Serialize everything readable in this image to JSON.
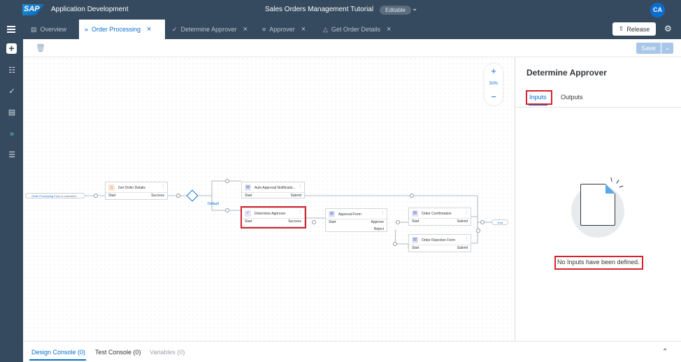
{
  "shell": {
    "logo_text": "SAP",
    "app_title": "Application Development",
    "project_title": "Sales Orders Management Tutorial",
    "status_badge": "Editable",
    "avatar_initials": "CA"
  },
  "tabs": [
    {
      "label": "Overview",
      "icon": "document-icon",
      "closable": false
    },
    {
      "label": "Order Processing",
      "icon": "process-icon",
      "closable": true,
      "active": true
    },
    {
      "label": "Determine Approver",
      "icon": "decision-icon",
      "closable": true
    },
    {
      "label": "Approver",
      "icon": "code-icon",
      "closable": true
    },
    {
      "label": "Get Order Details",
      "icon": "action-icon",
      "closable": true
    }
  ],
  "toolbar": {
    "release_label": "Release",
    "save_label": "Save"
  },
  "zoom": {
    "in": "+",
    "level": "50%",
    "out": "−"
  },
  "flow": {
    "trigger_label": "Order Processing Form",
    "trigger_suffix": "is submitted",
    "end_label": "End",
    "default_label": "Default",
    "nodes": {
      "get_order_details": {
        "title": "Get Order Details",
        "in": "Start",
        "out": "Success"
      },
      "auto_approval": {
        "title": "Auto Approval Notificatio...",
        "in": "Start",
        "out": "Submit"
      },
      "determine_approver": {
        "title": "Determine Approver",
        "in": "Start",
        "out": "Success"
      },
      "approval_form": {
        "title": "Approval Form",
        "in": "Start",
        "out": "Approve",
        "out2": "Reject"
      },
      "order_confirmation": {
        "title": "Order Confirmation",
        "in": "Start",
        "out": "Submit"
      },
      "order_rejection": {
        "title": "Order Rejection Form",
        "in": "Start",
        "out": "Submit"
      }
    }
  },
  "panel": {
    "title": "Determine Approver",
    "tabs": [
      "Inputs",
      "Outputs"
    ],
    "empty_message": "No Inputs have been defined."
  },
  "console": {
    "tabs": [
      "Design Console (0)",
      "Test Console (0)",
      "Variables (0)"
    ]
  }
}
